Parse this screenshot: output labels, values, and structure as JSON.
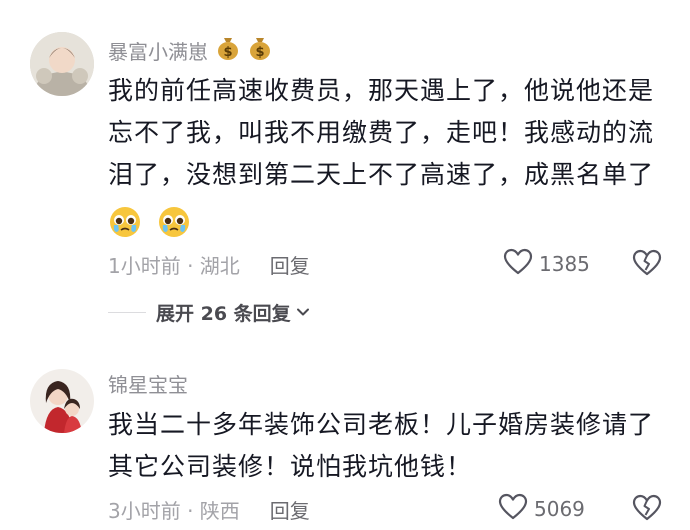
{
  "comments": [
    {
      "username": "暴富小满崽",
      "badges": [
        "money-bag-icon",
        "money-bag-icon"
      ],
      "lines": [
        "我的前任高速收费员，那天遇上了，他说他还是",
        "忘不了我，叫我不用缴费了，走吧！我感动的流",
        "泪了，没想到第二天上不了高速了，成黑名单了"
      ],
      "emojis": [
        "pleading-face-icon",
        "pleading-face-icon"
      ],
      "meta": "1小时前 · 湖北",
      "reply_label": "回复",
      "likes": "1385"
    },
    {
      "username": "锦星宝宝",
      "lines": [
        "我当二十多年装饰公司老板！儿子婚房装修请了",
        "其它公司装修！说怕我坑他钱！"
      ],
      "meta": "3小时前 · 陕西",
      "reply_label": "回复",
      "likes": "5069"
    }
  ],
  "expand_replies": "展开 26 条回复",
  "colors": {
    "text": "#161823",
    "secondary": "#8f8f95",
    "meta": "#a3a3a8"
  }
}
